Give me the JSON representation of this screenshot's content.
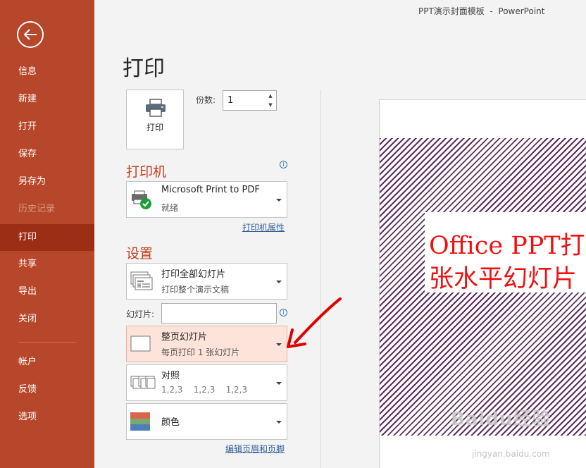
{
  "window": {
    "title": "PPT演示封面模板  -  PowerPoint"
  },
  "sidebar": {
    "items": [
      {
        "label": "信息"
      },
      {
        "label": "新建"
      },
      {
        "label": "打开"
      },
      {
        "label": "保存"
      },
      {
        "label": "另存为"
      },
      {
        "label": "历史记录",
        "disabled": true
      },
      {
        "label": "打印",
        "active": true
      },
      {
        "label": "共享"
      },
      {
        "label": "导出"
      },
      {
        "label": "关闭"
      },
      {
        "label": "帐户"
      },
      {
        "label": "反馈"
      },
      {
        "label": "选项"
      }
    ]
  },
  "print": {
    "title": "打印",
    "button_label": "打印",
    "copies_label": "份数:",
    "copies_value": "1"
  },
  "printer": {
    "heading": "打印机",
    "name": "Microsoft Print to PDF",
    "status": "就绪",
    "properties_link": "打印机属性"
  },
  "settings": {
    "heading": "设置",
    "range_main": "打印全部幻灯片",
    "range_sub": "打印整个演示文稿",
    "slides_label": "幻灯片:",
    "slides_value": "",
    "layout_main": "整页幻灯片",
    "layout_sub": "每页打印 1 张幻灯片",
    "collate_main": "对照",
    "collate_sub": "1,2,3    1,2,3    1,2,3",
    "color_main": "颜色",
    "header_footer_link": "编辑页眉和页脚"
  },
  "preview": {
    "line1": "Office PPT打",
    "line2": "张水平幻灯片"
  },
  "watermark": {
    "main": "Baidu经验",
    "sub": "jingyan.baidu.com"
  },
  "colors": {
    "sidebar": "#b7472a",
    "sidebar_active": "#9c2e16",
    "accent": "#c43e1c",
    "slide_text": "#ee1111",
    "slide_stripes": "#5b2e5d",
    "annotation_arrow": "#e00000"
  }
}
